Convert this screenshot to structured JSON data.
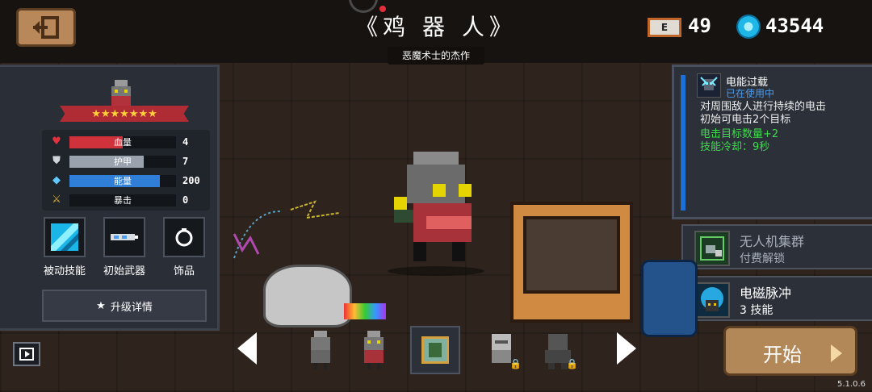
{
  "header": {
    "title": "《鸡 器 人》",
    "subtitle": "恶魔术士的杰作",
    "energy_label": "ENERGY",
    "energy_value": "49",
    "gems_value": "43544"
  },
  "character": {
    "stars_text": "★★★★★★★",
    "stars_count": 7,
    "stats": [
      {
        "label": "血量",
        "value": "4",
        "icon": "heart-icon",
        "fill": 0.5,
        "color": "#d0323c"
      },
      {
        "label": "护甲",
        "value": "7",
        "icon": "shield-icon",
        "fill": 0.7,
        "color": "#9aa3ad"
      },
      {
        "label": "能量",
        "value": "200",
        "icon": "diamond-icon",
        "fill": 0.85,
        "color": "#2f7fd8"
      },
      {
        "label": "暴击",
        "value": "0",
        "icon": "sword-icon",
        "fill": 0.0,
        "color": "#d8b02f"
      }
    ],
    "slots": [
      {
        "label": "被动技能"
      },
      {
        "label": "初始武器"
      },
      {
        "label": "饰品"
      }
    ],
    "upgrade_label": "升级详情"
  },
  "skill_info": {
    "name": "电能过载",
    "state": "已在使用中",
    "desc_line1": "对周围敌人进行持续的电击",
    "desc_line2": "初始可电击2个目标",
    "bonus_line1": "电击目标数量+2",
    "bonus_line2": "技能冷却：9秒"
  },
  "skills": [
    {
      "name": "无人机集群",
      "sub": "付费解锁",
      "locked": true
    },
    {
      "name": "电磁脉冲",
      "sub": "3 技能",
      "locked": false
    }
  ],
  "selector": {
    "selected_index": 2,
    "start_label": "开始"
  },
  "version": "5.1.0.6",
  "colors": {
    "accent_blue": "#1d6fd8",
    "bonus_green": "#3ddc4a",
    "ribbon_red": "#b02c34",
    "button_brown": "#b38859"
  }
}
